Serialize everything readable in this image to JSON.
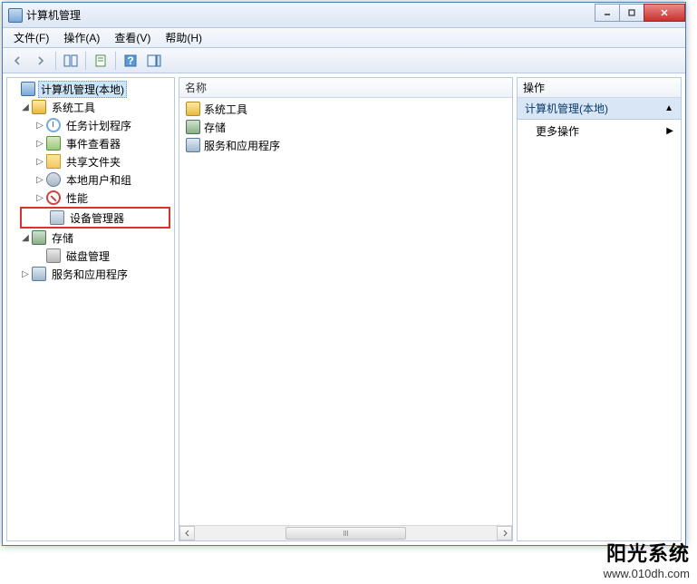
{
  "window": {
    "title": "计算机管理"
  },
  "menu": {
    "file": "文件(F)",
    "action": "操作(A)",
    "view": "查看(V)",
    "help": "帮助(H)"
  },
  "tree": {
    "root": "计算机管理(本地)",
    "system_tools": "系统工具",
    "task_scheduler": "任务计划程序",
    "event_viewer": "事件查看器",
    "shared_folders": "共享文件夹",
    "local_users": "本地用户和组",
    "performance": "性能",
    "device_manager": "设备管理器",
    "storage": "存储",
    "disk_management": "磁盘管理",
    "services_apps": "服务和应用程序"
  },
  "mid": {
    "header": "名称",
    "items": {
      "system_tools": "系统工具",
      "storage": "存储",
      "services_apps": "服务和应用程序"
    }
  },
  "actions": {
    "header": "操作",
    "group": "计算机管理(本地)",
    "more": "更多操作"
  },
  "watermark": {
    "brand": "阳光系统",
    "url": "www.010dh.com"
  }
}
